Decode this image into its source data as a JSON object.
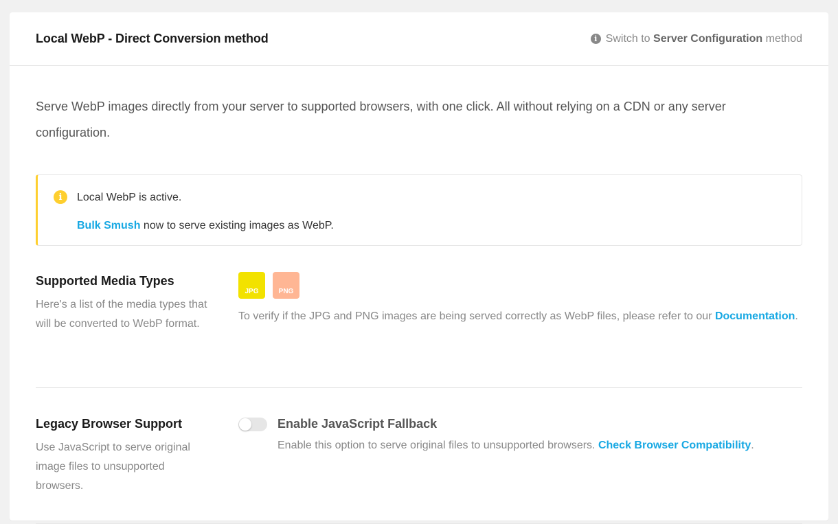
{
  "header": {
    "title": "Local WebP - Direct Conversion method",
    "switch_prefix": "Switch to",
    "switch_bold": "Server Configuration",
    "switch_suffix": "method"
  },
  "intro": "Serve WebP images directly from your server to supported browsers, with one click. All without relying on a CDN or any server configuration.",
  "notice": {
    "status": "Local WebP is active.",
    "link_label": "Bulk Smush",
    "text_after_link": " now to serve existing images as WebP.",
    "accent_color": "#fecf2f"
  },
  "media_types": {
    "label": "Supported Media Types",
    "description": "Here's a list of the media types that will be converted to WebP format.",
    "types": [
      {
        "label": "JPG",
        "color": "#f2e200"
      },
      {
        "label": "PNG",
        "color": "#ffb694"
      }
    ],
    "verify_text": "To verify if the JPG and PNG images are being served correctly as WebP files, please refer to our ",
    "doc_link": "Documentation",
    "verify_end": "."
  },
  "legacy": {
    "label": "Legacy Browser Support",
    "description": "Use JavaScript to serve original image files to unsupported browsers.",
    "toggle_label": "Enable JavaScript Fallback",
    "toggle_on": false,
    "toggle_desc": "Enable this option to serve original files to unsupported browsers. ",
    "compat_link": "Check Browser Compatibility",
    "desc_end": "."
  },
  "colors": {
    "link": "#17a8e3"
  }
}
